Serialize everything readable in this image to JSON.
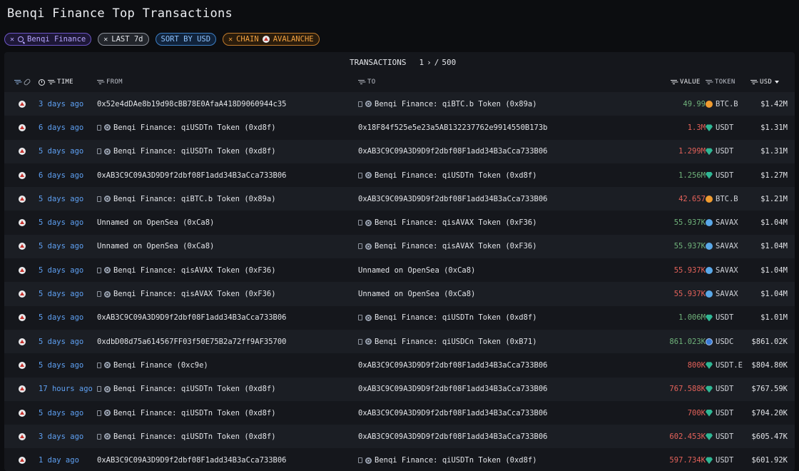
{
  "page": {
    "title": "Benqi Finance Top Transactions"
  },
  "filters": {
    "entity": "Benqi Finance",
    "time": "LAST 7d",
    "sort": "SORT BY USD",
    "chain_label": "CHAIN",
    "chain_value": "AVALANCHE"
  },
  "pager": {
    "label": "TRANSACTIONS",
    "page": "1",
    "separator": "/",
    "total": "500"
  },
  "columns": {
    "time": "TIME",
    "from": "FROM",
    "to": "TO",
    "value": "VALUE",
    "token": "TOKEN",
    "usd": "USD"
  },
  "colors": {
    "green": "#6fb27a",
    "red": "#e4625a",
    "link": "#5ea0f2"
  },
  "rows": [
    {
      "time": "3 days ago",
      "from": "0x52e4dDAe8b19d98cBB78E0AfaA418D9060944c35",
      "from_entity": false,
      "to": "Benqi Finance: qiBTC.b Token (0x89a)",
      "to_entity": true,
      "value": "49.99",
      "value_color": "green",
      "token": "BTC.B",
      "token_icon": "btc",
      "usd": "$1.42M"
    },
    {
      "time": "6 days ago",
      "from": "Benqi Finance: qiUSDTn Token (0xd8f)",
      "from_entity": true,
      "to": "0x18F84f525e5e23a5AB132237762e9914550B173b",
      "to_entity": false,
      "value": "1.3M",
      "value_color": "red",
      "token": "USDT",
      "token_icon": "usdt",
      "usd": "$1.31M"
    },
    {
      "time": "5 days ago",
      "from": "Benqi Finance: qiUSDTn Token (0xd8f)",
      "from_entity": true,
      "to": "0xAB3C9C09A3D9D9f2dbf08F1add34B3aCca733B06",
      "to_entity": false,
      "value": "1.299M",
      "value_color": "red",
      "token": "USDT",
      "token_icon": "usdt",
      "usd": "$1.31M"
    },
    {
      "time": "6 days ago",
      "from": "0xAB3C9C09A3D9D9f2dbf08F1add34B3aCca733B06",
      "from_entity": false,
      "to": "Benqi Finance: qiUSDTn Token (0xd8f)",
      "to_entity": true,
      "value": "1.256M",
      "value_color": "green",
      "token": "USDT",
      "token_icon": "usdt",
      "usd": "$1.27M"
    },
    {
      "time": "5 days ago",
      "from": "Benqi Finance: qiBTC.b Token (0x89a)",
      "from_entity": true,
      "to": "0xAB3C9C09A3D9D9f2dbf08F1add34B3aCca733B06",
      "to_entity": false,
      "value": "42.657",
      "value_color": "red",
      "token": "BTC.B",
      "token_icon": "btc",
      "usd": "$1.21M"
    },
    {
      "time": "5 days ago",
      "from": "Unnamed on OpenSea (0xCa8)",
      "from_entity": false,
      "to": "Benqi Finance: qisAVAX Token (0xF36)",
      "to_entity": true,
      "value": "55.937K",
      "value_color": "green",
      "token": "SAVAX",
      "token_icon": "savax",
      "usd": "$1.04M"
    },
    {
      "time": "5 days ago",
      "from": "Unnamed on OpenSea (0xCa8)",
      "from_entity": false,
      "to": "Benqi Finance: qisAVAX Token (0xF36)",
      "to_entity": true,
      "value": "55.937K",
      "value_color": "green",
      "token": "SAVAX",
      "token_icon": "savax",
      "usd": "$1.04M"
    },
    {
      "time": "5 days ago",
      "from": "Benqi Finance: qisAVAX Token (0xF36)",
      "from_entity": true,
      "to": "Unnamed on OpenSea (0xCa8)",
      "to_entity": false,
      "value": "55.937K",
      "value_color": "red",
      "token": "SAVAX",
      "token_icon": "savax",
      "usd": "$1.04M"
    },
    {
      "time": "5 days ago",
      "from": "Benqi Finance: qisAVAX Token (0xF36)",
      "from_entity": true,
      "to": "Unnamed on OpenSea (0xCa8)",
      "to_entity": false,
      "value": "55.937K",
      "value_color": "red",
      "token": "SAVAX",
      "token_icon": "savax",
      "usd": "$1.04M"
    },
    {
      "time": "5 days ago",
      "from": "0xAB3C9C09A3D9D9f2dbf08F1add34B3aCca733B06",
      "from_entity": false,
      "to": "Benqi Finance: qiUSDTn Token (0xd8f)",
      "to_entity": true,
      "value": "1.006M",
      "value_color": "green",
      "token": "USDT",
      "token_icon": "usdt",
      "usd": "$1.01M"
    },
    {
      "time": "5 days ago",
      "from": "0xdbD08d75a614567FF03f50E75B2a72ff9AF35700",
      "from_entity": false,
      "to": "Benqi Finance: qiUSDCn Token (0xB71)",
      "to_entity": true,
      "value": "861.023K",
      "value_color": "green",
      "token": "USDC",
      "token_icon": "usdc",
      "usd": "$861.02K"
    },
    {
      "time": "5 days ago",
      "from": "Benqi Finance (0xc9e)",
      "from_entity": true,
      "to": "0xAB3C9C09A3D9D9f2dbf08F1add34B3aCca733B06",
      "to_entity": false,
      "value": "800K",
      "value_color": "red",
      "token": "USDT.E",
      "token_icon": "usdt",
      "usd": "$804.80K"
    },
    {
      "time": "17 hours ago",
      "from": "Benqi Finance: qiUSDTn Token (0xd8f)",
      "from_entity": true,
      "to": "0xAB3C9C09A3D9D9f2dbf08F1add34B3aCca733B06",
      "to_entity": false,
      "value": "767.588K",
      "value_color": "red",
      "token": "USDT",
      "token_icon": "usdt",
      "usd": "$767.59K"
    },
    {
      "time": "5 days ago",
      "from": "Benqi Finance: qiUSDTn Token (0xd8f)",
      "from_entity": true,
      "to": "0xAB3C9C09A3D9D9f2dbf08F1add34B3aCca733B06",
      "to_entity": false,
      "value": "700K",
      "value_color": "red",
      "token": "USDT",
      "token_icon": "usdt",
      "usd": "$704.20K"
    },
    {
      "time": "3 days ago",
      "from": "Benqi Finance: qiUSDTn Token (0xd8f)",
      "from_entity": true,
      "to": "0xAB3C9C09A3D9D9f2dbf08F1add34B3aCca733B06",
      "to_entity": false,
      "value": "602.453K",
      "value_color": "red",
      "token": "USDT",
      "token_icon": "usdt",
      "usd": "$605.47K"
    },
    {
      "time": "1 day ago",
      "from": "0xAB3C9C09A3D9D9f2dbf08F1add34B3aCca733B06",
      "from_entity": false,
      "to": "Benqi Finance: qiUSDTn Token (0xd8f)",
      "to_entity": true,
      "value": "597.734K",
      "value_color": "red",
      "token": "USDT",
      "token_icon": "usdt",
      "usd": "$601.92K"
    }
  ]
}
